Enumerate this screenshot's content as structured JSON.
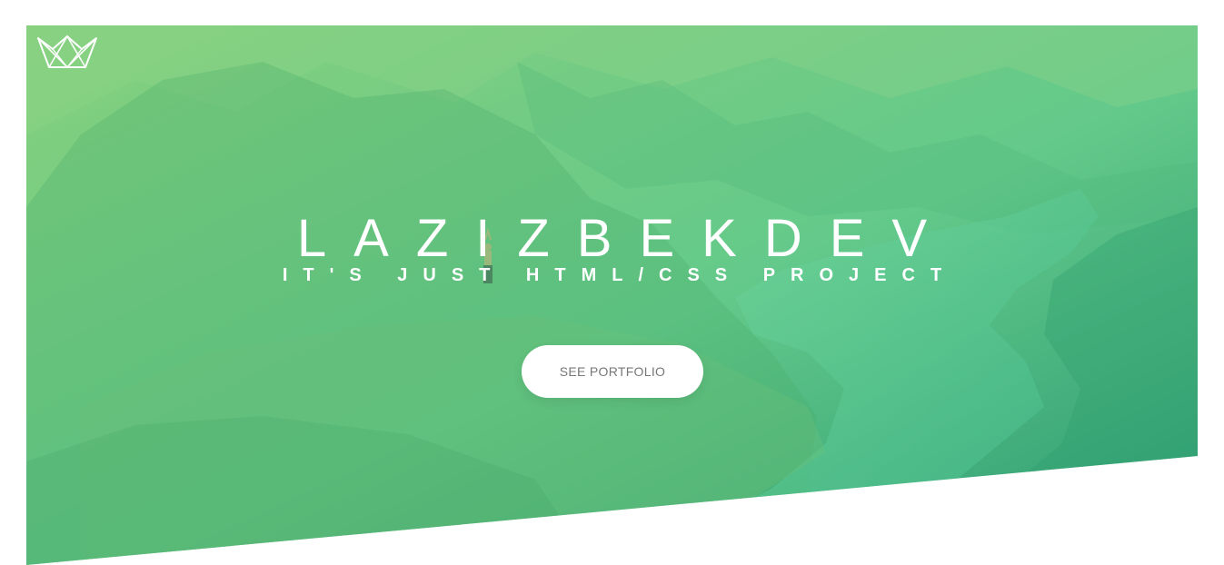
{
  "hero": {
    "title": "LAZIZBEKDEV",
    "subtitle": "IT'S JUST HTML/CSS PROJECT",
    "cta_label": "SEE PORTFOLIO",
    "logo_icon": "crown-outline-icon"
  },
  "colors": {
    "gradient_start": "#7fd07a",
    "gradient_end": "#2a9c72",
    "text": "#ffffff",
    "button_bg": "#ffffff",
    "button_text": "#777777",
    "page_bg": "#ffffff"
  }
}
